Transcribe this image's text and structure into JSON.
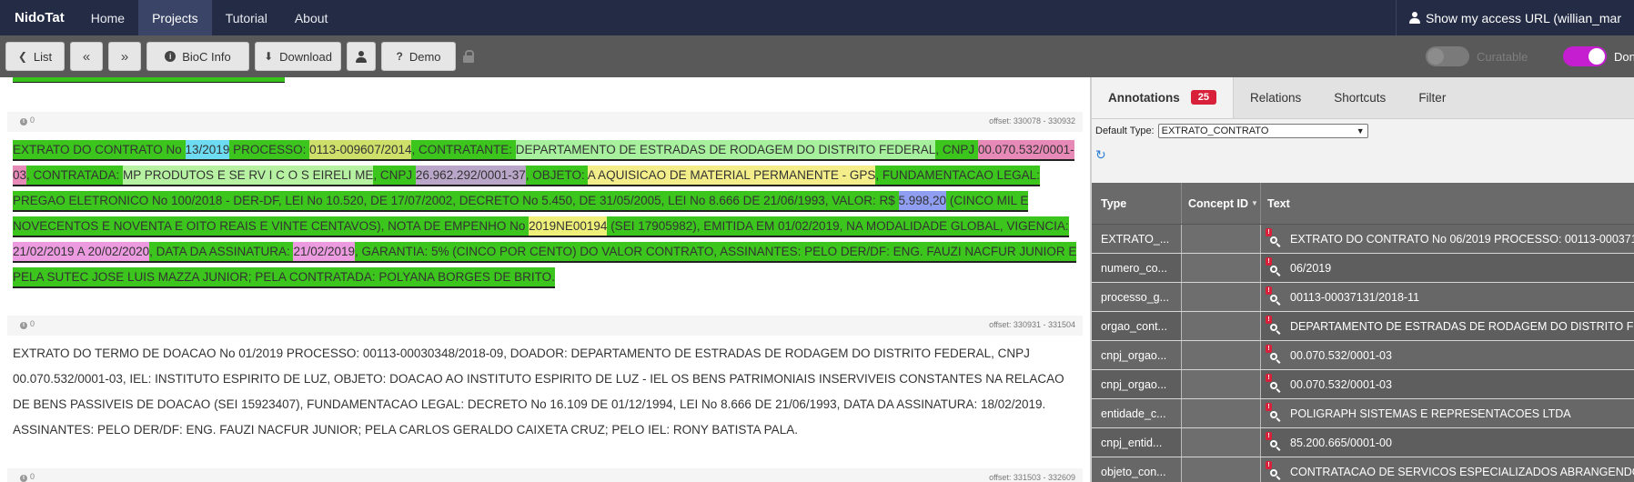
{
  "navbar": {
    "brand": "NidoTat",
    "items": [
      "Home",
      "Projects",
      "Tutorial",
      "About"
    ],
    "active": "Projects",
    "access_url": "Show my access URL (willian_mar"
  },
  "toolbar": {
    "list": "List",
    "bioc_info": "BioC Info",
    "download": "Download",
    "demo": "Demo",
    "curatable": "Curatable",
    "done": "Don",
    "icons": [
      "chevron-left-icon",
      "double-left-icon",
      "double-right-icon",
      "info-icon",
      "download-icon",
      "user-icon",
      "question-icon",
      "lock-icon"
    ]
  },
  "passages": [
    {
      "badge": "0",
      "offset": "offset: 330078 - 330932",
      "segments": [
        {
          "t": "EXTRATO DO CONTRATO No ",
          "c": "ext"
        },
        {
          "t": "13/2019",
          "c": "num"
        },
        {
          "t": " PROCESSO: ",
          "c": "ext"
        },
        {
          "t": "0113-009607/2014",
          "c": "proc"
        },
        {
          "t": ", CONTRATANTE: ",
          "c": "ext"
        },
        {
          "t": "DEPARTAMENTO DE ESTRADAS DE RODAGEM DO DISTRITO FEDERAL",
          "c": "org"
        },
        {
          "t": ", CNPJ ",
          "c": "ext"
        },
        {
          "t": "00.070.532/0001-03",
          "c": "cnpj1"
        },
        {
          "t": ", CONTRATADA: ",
          "c": "ext"
        },
        {
          "t": "MP PRODUTOS E SE RV I C O S EIRELI ME",
          "c": "ent"
        },
        {
          "t": ", CNPJ ",
          "c": "ext"
        },
        {
          "t": "26.962.292/0001-37",
          "c": "cnpj2"
        },
        {
          "t": ", OBJETO: ",
          "c": "ext"
        },
        {
          "t": "A AQUISICAO DE MATERIAL PERMANENTE - GPS",
          "c": "obj"
        },
        {
          "t": ", FUNDAMENTACAO LEGAL: PREGAO ELETRONICO No 100/2018 - DER-DF, LEI No 10.520, DE 17/07/2002, DECRETO No 5.450, DE 31/05/2005, LEI No 8.666 DE 21/06/1993, VALOR: R$ ",
          "c": "ext"
        },
        {
          "t": "5.998,20",
          "c": "val"
        },
        {
          "t": " (CINCO MIL E NOVECENTOS E NOVENTA E OITO REAIS E VINTE CENTAVOS), NOTA DE EMPENHO No ",
          "c": "ext"
        },
        {
          "t": "2019NE00194",
          "c": "ne"
        },
        {
          "t": " (SEI 17905982), EMITIDA EM 01/02/2019, NA MODALIDADE GLOBAL, VIGENCIA: ",
          "c": "ext"
        },
        {
          "t": "21/02/2019 A 20/02/2020",
          "c": "date"
        },
        {
          "t": ", DATA DA ASSINATURA: ",
          "c": "ext"
        },
        {
          "t": "21/02/2019",
          "c": "date"
        },
        {
          "t": ", GARANTIA: 5% (CINCO POR CENTO) DO VALOR CONTRATO, ASSINANTES: PELO DER/DF: ENG. FAUZI NACFUR JUNIOR E PELA SUTEC JOSE LUIS MAZZA JUNIOR; PELA CONTRATADA: POLYANA BORGES DE BRITO.",
          "c": "ext"
        }
      ]
    },
    {
      "badge": "0",
      "offset": "offset: 330931 - 331504",
      "segments": [
        {
          "t": "EXTRATO DO TERMO DE DOACAO No 01/2019 PROCESSO: 00113-00030348/2018-09, DOADOR: DEPARTAMENTO DE ESTRADAS DE RODAGEM DO DISTRITO FEDERAL, CNPJ 00.070.532/0001-03, IEL: INSTITUTO ESPIRITO DE LUZ, OBJETO: DOACAO AO INSTITUTO ESPIRITO DE LUZ - IEL OS BENS PATRIMONIAIS INSERVIVEIS CONSTANTES NA RELACAO DE BENS PASSIVEIS DE DOACAO (SEI 15923407), FUNDAMENTACAO LEGAL: DECRETO No 16.109 DE 01/12/1994, LEI No 8.666 DE 21/06/1993, DATA DA ASSINATURA: 18/02/2019. ASSINANTES: PELO DER/DF: ENG. FAUZI NACFUR JUNIOR; PELA CARLOS GERALDO CAIXETA CRUZ; PELO IEL: RONY BATISTA PALA.",
          "c": ""
        }
      ]
    },
    {
      "badge": "0",
      "offset": "offset: 331503 - 332609",
      "segments": []
    }
  ],
  "right": {
    "tabs": [
      {
        "label": "Annotations",
        "count": "25"
      },
      {
        "label": "Relations"
      },
      {
        "label": "Shortcuts"
      },
      {
        "label": "Filter"
      }
    ],
    "default_type_label": "Default Type:",
    "default_type_value": "EXTRATO_CONTRATO",
    "columns": [
      "Type",
      "Concept ID",
      "Text"
    ],
    "rows": [
      {
        "type": "EXTRATO_...",
        "concept": "",
        "text": "EXTRATO DO CONTRATO No 06/2019 PROCESSO: 00113-00037131"
      },
      {
        "type": "numero_co...",
        "concept": "",
        "text": "06/2019"
      },
      {
        "type": "processo_g...",
        "concept": "",
        "text": "00113-00037131/2018-11"
      },
      {
        "type": "orgao_cont...",
        "concept": "",
        "text": "DEPARTAMENTO DE ESTRADAS DE RODAGEM DO DISTRITO FEDER"
      },
      {
        "type": "cnpj_orgao...",
        "concept": "",
        "text": "00.070.532/0001-03"
      },
      {
        "type": "cnpj_orgao...",
        "concept": "",
        "text": "00.070.532/0001-03"
      },
      {
        "type": "entidade_c...",
        "concept": "",
        "text": "POLIGRAPH SISTEMAS E REPRESENTACOES LTDA"
      },
      {
        "type": "cnpj_entid...",
        "concept": "",
        "text": "85.200.665/0001-00"
      },
      {
        "type": "objeto_con...",
        "concept": "",
        "text": "CONTRATACAO DE SERVICOS ESPECIALIZADOS ABRANGENDO S"
      }
    ]
  },
  "colors": {
    "navbar": "#232b45",
    "toolbar": "#595959",
    "extrato_green": "#3cc51c",
    "count_badge": "#d8203a",
    "done_toggle": "#c41ed0"
  }
}
